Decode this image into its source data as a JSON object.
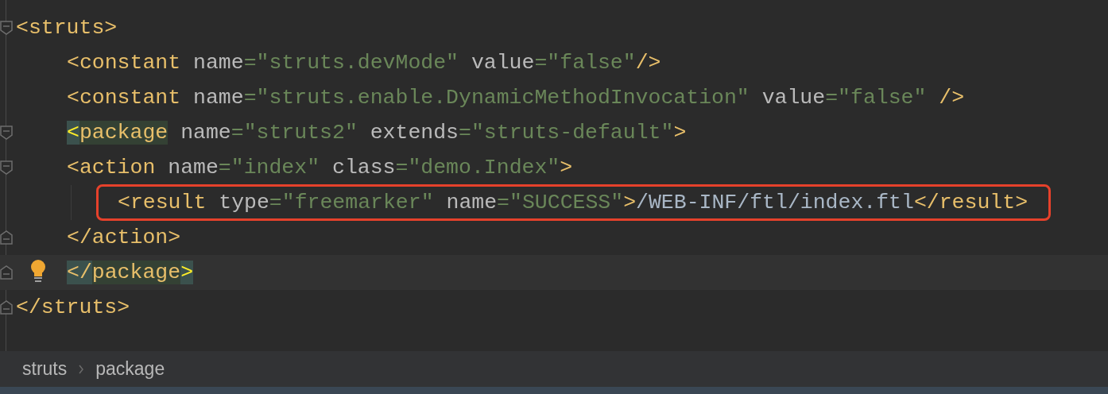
{
  "editor": {
    "nodes": [
      {
        "expanded": true,
        "open": {
          "tokens": [
            {
              "kind": "tag",
              "text": "<struts>"
            }
          ]
        },
        "children": [
          {
            "line": {
              "tokens": [
                {
                  "kind": "tag",
                  "text": "<constant"
                },
                {
                  "kind": "attr",
                  "text": " name"
                },
                {
                  "kind": "eq",
                  "text": "="
                },
                {
                  "kind": "string",
                  "text": "\"struts.devMode\""
                },
                {
                  "kind": "attr",
                  "text": " value"
                },
                {
                  "kind": "eq",
                  "text": "="
                },
                {
                  "kind": "string",
                  "text": "\"false\""
                },
                {
                  "kind": "tag",
                  "text": "/>"
                }
              ]
            }
          },
          {
            "line": {
              "tokens": [
                {
                  "kind": "tag",
                  "text": "<constant"
                },
                {
                  "kind": "attr",
                  "text": " name"
                },
                {
                  "kind": "eq",
                  "text": "="
                },
                {
                  "kind": "string",
                  "text": "\"struts.enable.DynamicMethodInvocation\""
                },
                {
                  "kind": "attr",
                  "text": " value"
                },
                {
                  "kind": "eq",
                  "text": "="
                },
                {
                  "kind": "string",
                  "text": "\"false\""
                },
                {
                  "kind": "tag",
                  "text": " />"
                }
              ]
            }
          },
          {
            "expanded": true,
            "children_indented": false,
            "open": {
              "tokens": [
                {
                  "kind": "bracket-match",
                  "text": "<"
                },
                {
                  "kind": "tag-match",
                  "text": "package"
                },
                {
                  "kind": "attr",
                  "text": " name"
                },
                {
                  "kind": "eq",
                  "text": "="
                },
                {
                  "kind": "string",
                  "text": "\"struts2\""
                },
                {
                  "kind": "attr",
                  "text": " extends"
                },
                {
                  "kind": "eq",
                  "text": "="
                },
                {
                  "kind": "string",
                  "text": "\"struts-default\""
                },
                {
                  "kind": "tag",
                  "text": ">"
                }
              ]
            },
            "children": [
              {
                "expanded": true,
                "open": {
                  "tokens": [
                    {
                      "kind": "tag",
                      "text": "<action"
                    },
                    {
                      "kind": "attr",
                      "text": " name"
                    },
                    {
                      "kind": "eq",
                      "text": "="
                    },
                    {
                      "kind": "string",
                      "text": "\"index\""
                    },
                    {
                      "kind": "attr",
                      "text": " class"
                    },
                    {
                      "kind": "eq",
                      "text": "="
                    },
                    {
                      "kind": "string",
                      "text": "\"demo.Index\""
                    },
                    {
                      "kind": "tag",
                      "text": ">"
                    }
                  ]
                },
                "children": [
                  {
                    "line": {
                      "boxed": true,
                      "tokens": [
                        {
                          "kind": "tag",
                          "text": "<result"
                        },
                        {
                          "kind": "attr",
                          "text": " type"
                        },
                        {
                          "kind": "eq",
                          "text": "="
                        },
                        {
                          "kind": "string",
                          "text": "\"freemarker\""
                        },
                        {
                          "kind": "attr",
                          "text": " name"
                        },
                        {
                          "kind": "eq",
                          "text": "="
                        },
                        {
                          "kind": "string",
                          "text": "\"SUCCESS\""
                        },
                        {
                          "kind": "tag",
                          "text": ">"
                        },
                        {
                          "kind": "text",
                          "text": "/WEB-INF/ftl/index.ftl"
                        },
                        {
                          "kind": "tag",
                          "text": "</result>"
                        }
                      ]
                    }
                  }
                ],
                "close": {
                  "tokens": [
                    {
                      "kind": "tag",
                      "text": "</action>"
                    }
                  ]
                }
              }
            ],
            "close": {
              "current": true,
              "bulb": true,
              "tokens": [
                {
                  "kind": "bracket-dim",
                  "text": "</"
                },
                {
                  "kind": "tag-match",
                  "text": "package"
                },
                {
                  "kind": "bracket-match",
                  "text": ">"
                }
              ]
            }
          }
        ],
        "close": {
          "tokens": [
            {
              "kind": "tag",
              "text": "</struts>"
            }
          ]
        }
      }
    ]
  },
  "breadcrumbs": [
    "struts",
    "package"
  ]
}
